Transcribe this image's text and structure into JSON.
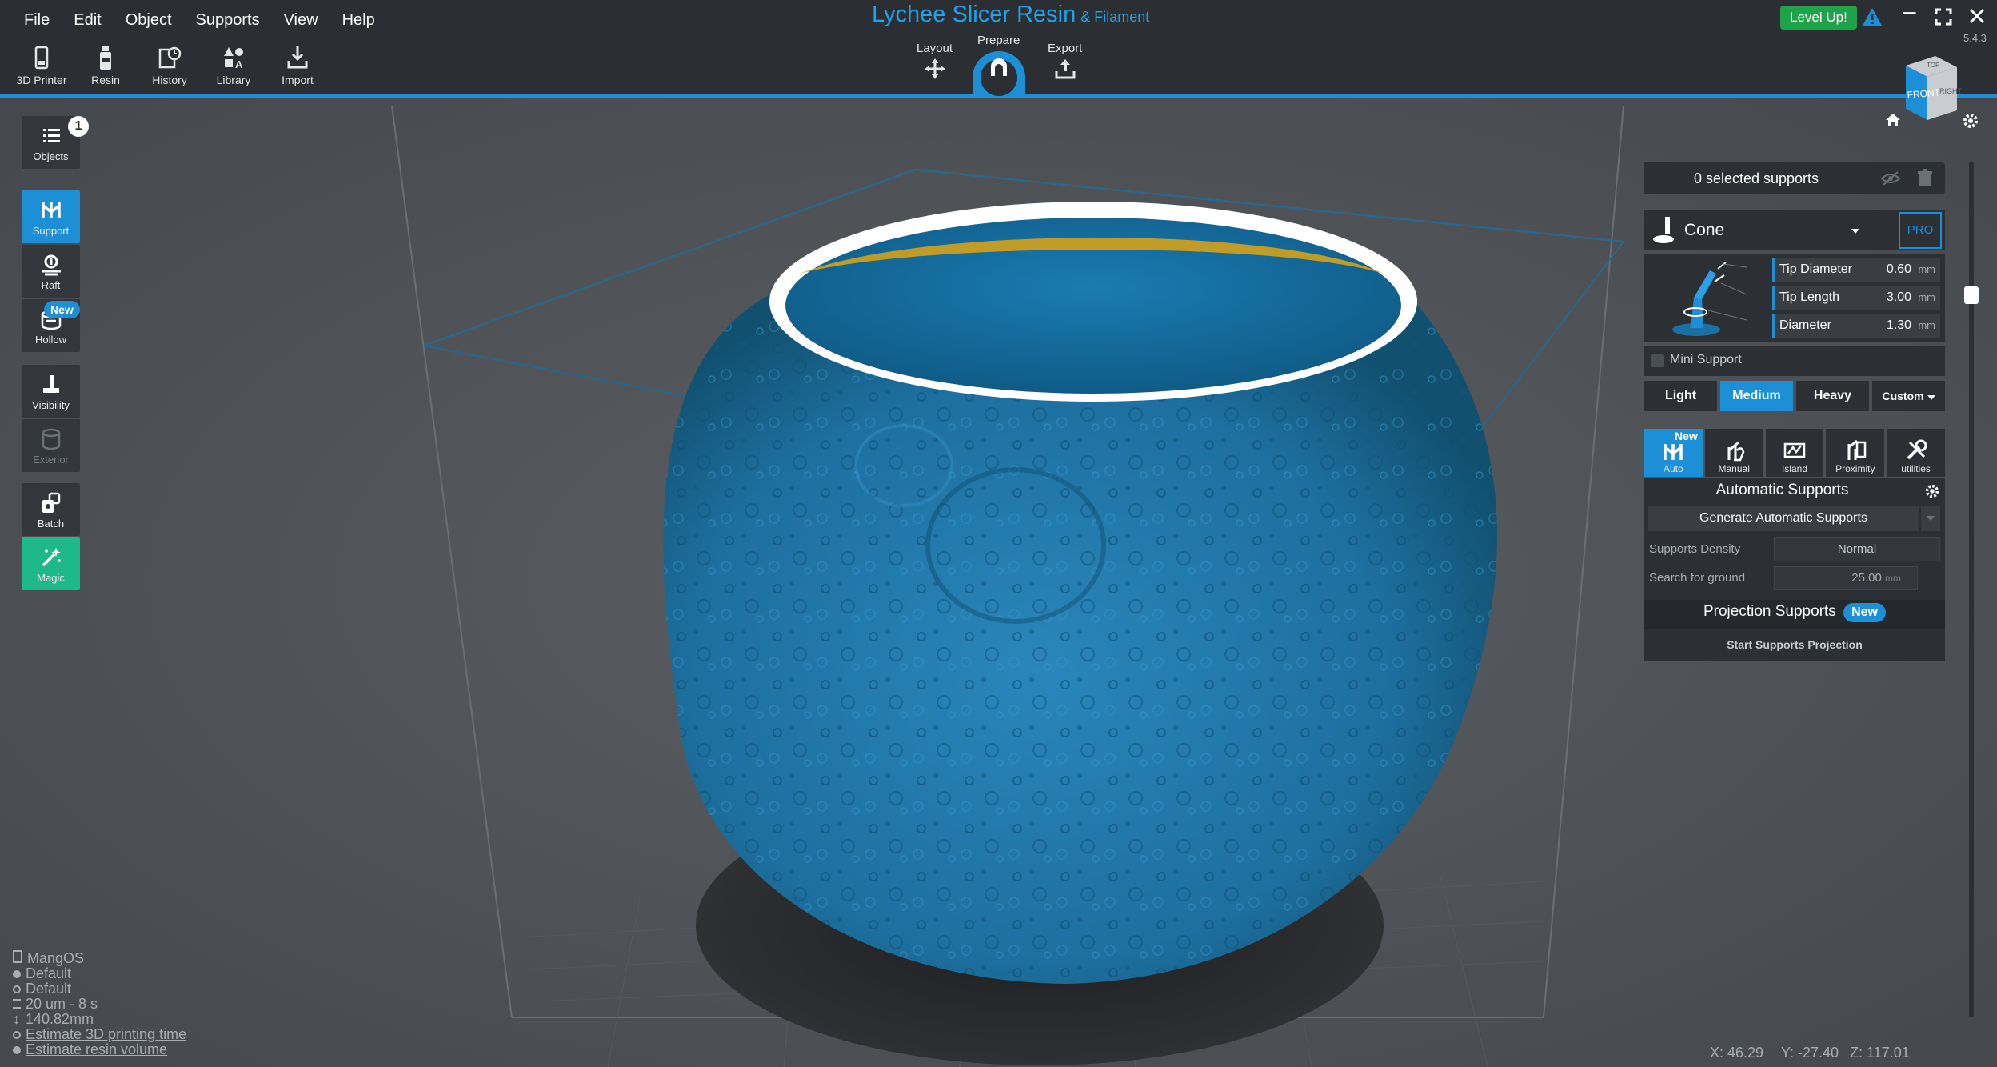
{
  "menu": [
    "File",
    "Edit",
    "Object",
    "Supports",
    "View",
    "Help"
  ],
  "app": {
    "title": "Lychee Slicer Resin",
    "subtitle": "& Filament",
    "version": "5.4.3",
    "level_button": "Level Up!"
  },
  "toolbar": [
    {
      "label": "3D Printer",
      "icon": "printer-icon"
    },
    {
      "label": "Resin",
      "icon": "resin-bottle-icon"
    },
    {
      "label": "History",
      "icon": "history-icon"
    },
    {
      "label": "Library",
      "icon": "library-shapes-icon"
    },
    {
      "label": "Import",
      "icon": "import-icon"
    }
  ],
  "stages": {
    "layout": "Layout",
    "prepare": "Prepare",
    "export": "Export",
    "active": "Prepare"
  },
  "view_cube": {
    "front": "FRONT",
    "side": "RIGHT",
    "top": "TOP"
  },
  "left_tools": {
    "objects": "Objects",
    "objects_count": "1",
    "support": "Support",
    "raft": "Raft",
    "hollow": "Hollow",
    "hollow_badge": "New",
    "visibility": "Visibility",
    "exterior": "Exterior",
    "batch": "Batch",
    "magic": "Magic"
  },
  "supports_panel": {
    "selected": "0 selected supports",
    "type": "Cone",
    "pro": "PRO",
    "params": [
      {
        "label": "Tip Diameter",
        "value": "0.60",
        "unit": "mm"
      },
      {
        "label": "Tip Length",
        "value": "3.00",
        "unit": "mm"
      },
      {
        "label": "Diameter",
        "value": "1.30",
        "unit": "mm"
      }
    ],
    "mini_support": "Mini Support",
    "weights": [
      "Light",
      "Medium",
      "Heavy",
      "Custom"
    ],
    "active_weight": "Medium",
    "modes": [
      {
        "label": "Auto",
        "badge": "New",
        "icon": "auto-support-icon"
      },
      {
        "label": "Manual",
        "icon": "manual-support-icon"
      },
      {
        "label": "Island",
        "icon": "island-icon"
      },
      {
        "label": "Proximity",
        "icon": "proximity-icon"
      },
      {
        "label": "utilities",
        "icon": "utilities-icon"
      }
    ],
    "auto_title": "Automatic Supports",
    "generate_button": "Generate Automatic Supports",
    "density_label": "Supports Density",
    "density_value": "Normal",
    "ground_label": "Search for ground",
    "ground_value": "25.00",
    "ground_unit": "mm",
    "projection_title": "Projection Supports",
    "projection_badge": "New",
    "projection_button": "Start Supports Projection"
  },
  "info": {
    "printer": "MangOS",
    "resin": "Default",
    "profile": "Default",
    "layer": "20 um - 8 s",
    "height": "140.82mm",
    "time_link": "Estimate 3D printing time",
    "volume_link": "Estimate resin volume"
  },
  "coords": {
    "x": "X: 46.29",
    "y": "Y: -27.40",
    "z": "Z: 117.01"
  },
  "colors": {
    "accent": "#1d8fd6",
    "magic": "#1db98a",
    "model": "#1f74a6",
    "background": "#505357"
  }
}
